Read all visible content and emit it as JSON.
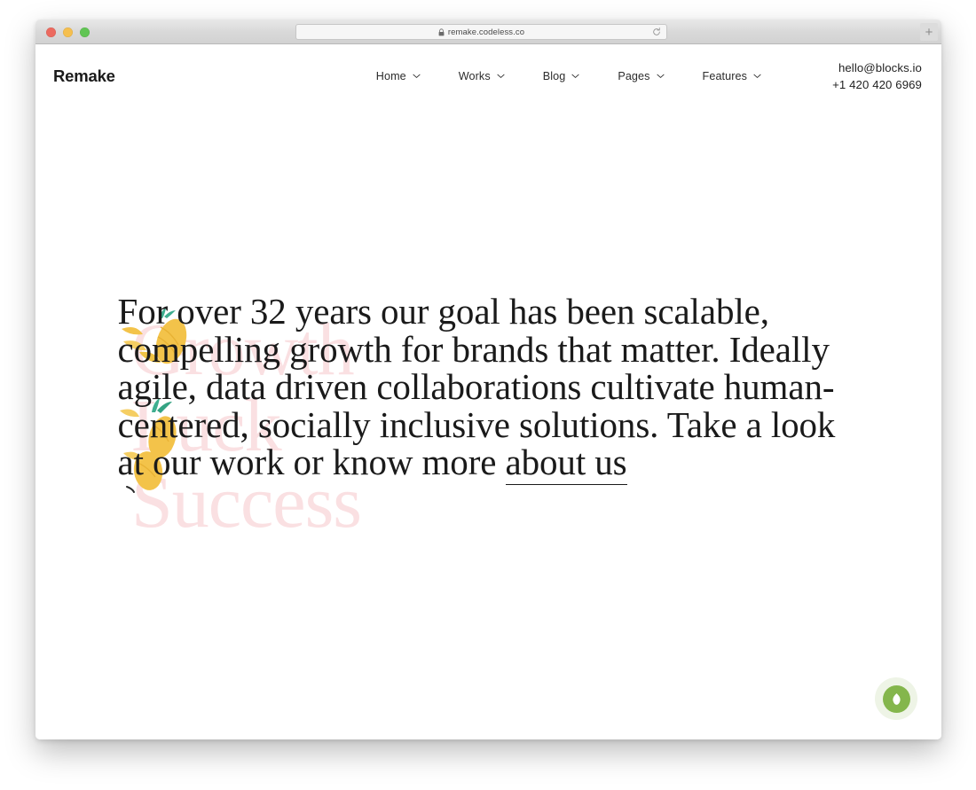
{
  "browser": {
    "url": "remake.codeless.co",
    "lock_icon": "lock-icon",
    "reload_icon": "reload-icon",
    "new_tab_label": "+",
    "traffic_lights": [
      "close",
      "minimize",
      "maximize"
    ]
  },
  "header": {
    "logo": "Remake",
    "nav": [
      {
        "label": "Home",
        "caret": "chevron-down-icon"
      },
      {
        "label": "Works",
        "caret": "chevron-down-icon"
      },
      {
        "label": "Blog",
        "caret": "chevron-down-icon"
      },
      {
        "label": "Pages",
        "caret": "chevron-down-icon"
      },
      {
        "label": "Features",
        "caret": "chevron-down-icon"
      }
    ],
    "contact": {
      "email": "hello@blocks.io",
      "phone": "+1 420 420 6969"
    }
  },
  "hero": {
    "watermarks": [
      "Growth",
      "Luck",
      "Success"
    ],
    "headline_lines": [
      "For over 32 years our goal has been scalable, compelling",
      "growth for brands that matter. Ideally agile, data driven",
      "collaborations cultivate human-centered, socially inclusive",
      "solutions. Take a look at our work or know more "
    ],
    "link_label": "about us"
  },
  "fab": {
    "icon": "leaf-icon"
  },
  "colors": {
    "watermark_pink": "#fae0e2",
    "pineapple_yellow": "#f5c542",
    "pineapple_leaf_green": "#3fae8f",
    "fab_green": "#84b64c",
    "fab_halo": "#eef4e6",
    "text_dark": "#1a1a1a"
  }
}
